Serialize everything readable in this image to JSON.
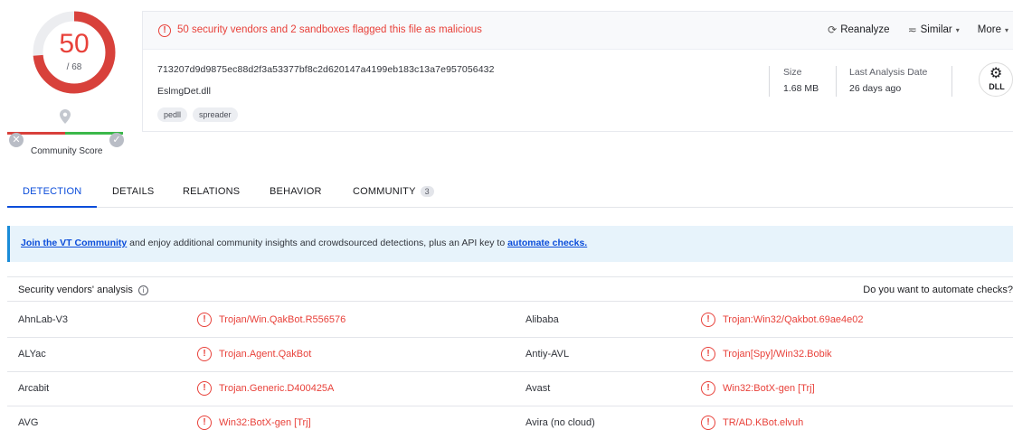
{
  "score": {
    "detections": "50",
    "total": "/ 68",
    "community_label": "Community Score",
    "x_symbol": "✕",
    "check_symbol": "✓"
  },
  "header": {
    "alert_icon": "!",
    "alert_text": "50 security vendors and 2 sandboxes flagged this file as malicious",
    "actions": {
      "reanalyze_icon": "⟳",
      "reanalyze": "Reanalyze",
      "similar_icon": "≂",
      "similar": "Similar",
      "more": "More",
      "caret": "▾"
    },
    "hash": "713207d9d9875ec88d2f3a53377bf8c2d620147a4199eb183c13a7e957056432",
    "filename": "EslmgDet.dll",
    "tags": [
      "pedll",
      "spreader"
    ],
    "size_label": "Size",
    "size_value": "1.68 MB",
    "date_label": "Last Analysis Date",
    "date_value": "26 days ago",
    "filetype": "DLL",
    "filetype_icon": "gear-icon"
  },
  "tabs": [
    {
      "label": "DETECTION",
      "active": true
    },
    {
      "label": "DETAILS"
    },
    {
      "label": "RELATIONS"
    },
    {
      "label": "BEHAVIOR"
    },
    {
      "label": "COMMUNITY",
      "badge": "3"
    }
  ],
  "banner": {
    "link1": "Join the VT Community",
    "text": " and enjoy additional community insights and crowdsourced detections, plus an API key to ",
    "link2": "automate checks."
  },
  "analysis": {
    "title": "Security vendors' analysis",
    "info_symbol": "i",
    "right_text": "Do you want to automate checks?",
    "detect_symbol": "!",
    "rows": [
      {
        "v1": "AhnLab-V3",
        "d1": "Trojan/Win.QakBot.R556576",
        "v2": "Alibaba",
        "d2": "Trojan:Win32/Qakbot.69ae4e02"
      },
      {
        "v1": "ALYac",
        "d1": "Trojan.Agent.QakBot",
        "v2": "Antiy-AVL",
        "d2": "Trojan[Spy]/Win32.Bobik"
      },
      {
        "v1": "Arcabit",
        "d1": "Trojan.Generic.D400425A",
        "v2": "Avast",
        "d2": "Win32:BotX-gen [Trj]"
      },
      {
        "v1": "AVG",
        "d1": "Win32:BotX-gen [Trj]",
        "v2": "Avira (no cloud)",
        "d2": "TR/AD.KBot.elvuh"
      }
    ]
  },
  "colors": {
    "malicious": "#e8413a",
    "accent": "#0b4dda",
    "banner_bg": "#e7f3fb"
  }
}
